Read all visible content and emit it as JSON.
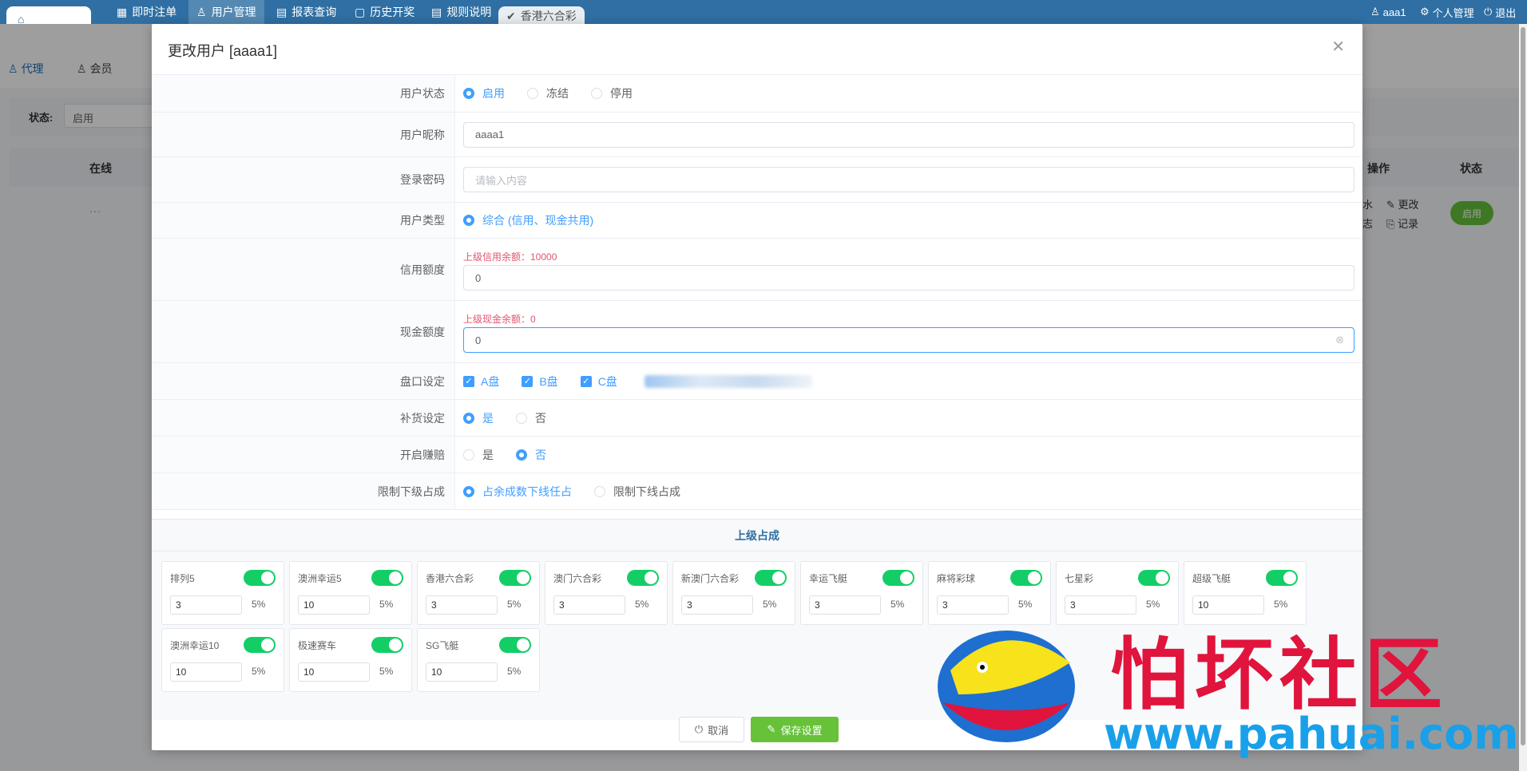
{
  "topnav": {
    "tabs": [
      {
        "label": "即时注单"
      },
      {
        "label": "用户管理"
      },
      {
        "label": "报表查询"
      },
      {
        "label": "历史开奖"
      },
      {
        "label": "规则说明"
      },
      {
        "label": "香港六合彩"
      }
    ],
    "user": "aaa1",
    "profile": "个人管理",
    "logout": "退出"
  },
  "page": {
    "subtabs": [
      {
        "label": "代理"
      },
      {
        "label": "会员"
      }
    ],
    "filter_label": "状态:",
    "filter_value": "启用",
    "col_online": "在线",
    "col_ops": "操作",
    "col_status": "状态",
    "row_dots": "···",
    "op_edit": "更改",
    "op_log": "记录",
    "op_flow": "水",
    "op_log2": "志",
    "status_btn": "启用"
  },
  "dialog": {
    "title": "更改用户 [aaaa1]",
    "status": {
      "label": "用户状态",
      "options": [
        "启用",
        "冻结",
        "停用"
      ],
      "selected": "启用"
    },
    "nickname": {
      "label": "用户昵称",
      "value": "aaaa1"
    },
    "password": {
      "label": "登录密码",
      "placeholder": "请输入内容"
    },
    "user_type": {
      "label": "用户类型",
      "option": "综合 (信用、现金共用)"
    },
    "credit": {
      "label": "信用额度",
      "hint": "上级信用余额：10000",
      "value": "0"
    },
    "cash": {
      "label": "现金额度",
      "hint": "上级现金余额：0",
      "value": "0"
    },
    "plate": {
      "label": "盘口设定",
      "options": [
        "A盘",
        "B盘",
        "C盘"
      ]
    },
    "restock": {
      "label": "补货设定",
      "options": [
        "是",
        "否"
      ],
      "selected": "是"
    },
    "gift": {
      "label": "开启赚赔",
      "options": [
        "是",
        "否"
      ],
      "selected": "否"
    },
    "limit": {
      "label": "限制下级占成",
      "options": [
        "占余成数下线任占",
        "限制下线占成"
      ],
      "selected": "占余成数下线任占"
    },
    "share_title": "上级占成",
    "games": [
      {
        "name": "排列5",
        "value": "3",
        "pct": "5%"
      },
      {
        "name": "澳洲幸运5",
        "value": "10",
        "pct": "5%"
      },
      {
        "name": "香港六合彩",
        "value": "3",
        "pct": "5%"
      },
      {
        "name": "澳门六合彩",
        "value": "3",
        "pct": "5%"
      },
      {
        "name": "新澳门六合彩",
        "value": "3",
        "pct": "5%"
      },
      {
        "name": "幸运飞艇",
        "value": "3",
        "pct": "5%"
      },
      {
        "name": "麻将彩球",
        "value": "3",
        "pct": "5%"
      },
      {
        "name": "七星彩",
        "value": "3",
        "pct": "5%"
      },
      {
        "name": "超级飞艇",
        "value": "10",
        "pct": "5%"
      },
      {
        "name": "澳洲幸运10",
        "value": "10",
        "pct": "5%"
      },
      {
        "name": "极速赛车",
        "value": "10",
        "pct": "5%"
      },
      {
        "name": "SG飞艇",
        "value": "10",
        "pct": "5%"
      }
    ],
    "cancel": "取消",
    "save": "保存设置"
  },
  "watermark": {
    "cn": "怕坏社区",
    "url": "www.pahuai.com"
  },
  "colors": {
    "primary": "#409eff",
    "nav": "#2f6fa3",
    "switch_on": "#13ce66",
    "save": "#67c23a",
    "hint": "#e0566f"
  }
}
